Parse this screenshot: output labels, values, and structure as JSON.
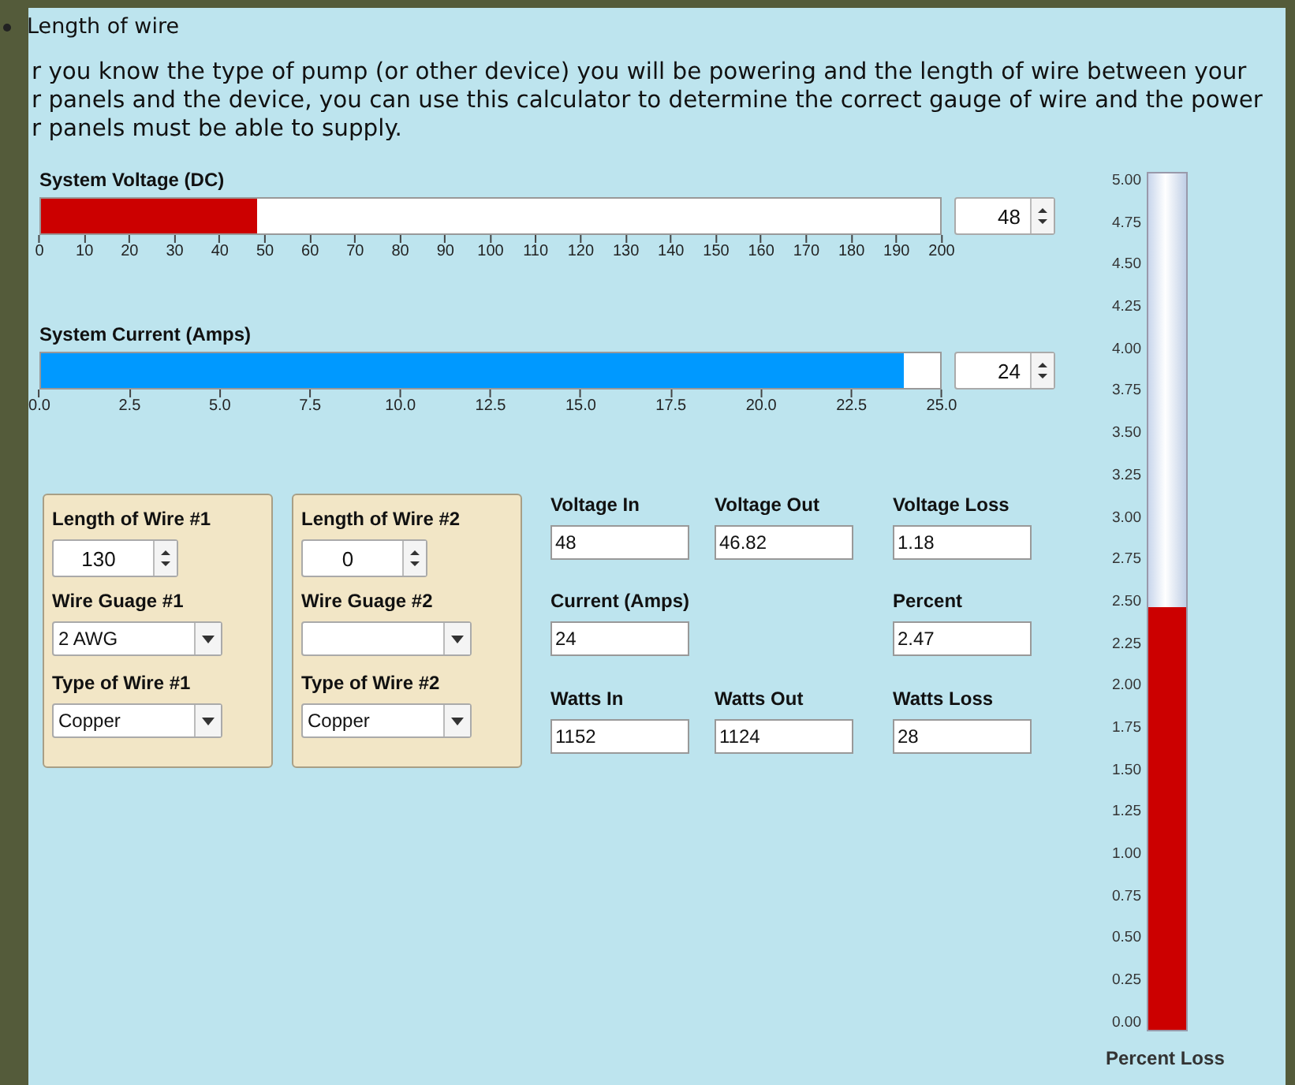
{
  "intro": {
    "bullet_item": "Length of wire",
    "paragraph_lines": [
      "r you know the type of pump (or other device) you will be powering and the length of wire between your",
      "r panels and the device, you can use this calculator to determine the correct gauge of wire and the power",
      "r panels must be able to supply."
    ]
  },
  "sliders": [
    {
      "label": "System Voltage (DC)",
      "level": 0.24,
      "color": "#cc0000",
      "value": "48",
      "ticks": [
        "0",
        "10",
        "20",
        "30",
        "40",
        "50",
        "60",
        "70",
        "80",
        "90",
        "100",
        "110",
        "120",
        "130",
        "140",
        "150",
        "160",
        "170",
        "180",
        "190",
        "200"
      ]
    },
    {
      "label": "System Current (Amps)",
      "level": 0.96,
      "color": "#0099ff",
      "value": "24",
      "ticks": [
        "0.0",
        "2.5",
        "5.0",
        "7.5",
        "10.0",
        "12.5",
        "15.0",
        "17.5",
        "20.0",
        "22.5",
        "25.0"
      ]
    }
  ],
  "wires": [
    {
      "length_label": "Length of Wire #1",
      "length": "130",
      "gauge_label": "Wire Guage #1",
      "gauge": "2 AWG",
      "type_label": "Type of Wire #1",
      "type": "Copper"
    },
    {
      "length_label": "Length of Wire #2",
      "length": "0",
      "gauge_label": "Wire Guage #2",
      "type_label": "Type of Wire #2",
      "type": "Copper"
    }
  ],
  "results": [
    {
      "left": {
        "label": "Voltage In",
        "value": "48"
      },
      "middle": {
        "label": "Voltage Out",
        "value": "46.82"
      },
      "right": {
        "label": "Voltage Loss",
        "value": "1.18"
      }
    },
    {
      "left": {
        "label": "Current (Amps)",
        "value": "24"
      },
      "right": {
        "label": "Percent",
        "value": "2.47"
      }
    },
    {
      "left": {
        "label": "Watts In",
        "value": "1152"
      },
      "middle": {
        "label": "Watts Out",
        "value": "1124"
      },
      "right": {
        "label": "Watts Loss",
        "value": "28"
      }
    }
  ],
  "meter": {
    "level": 0.494,
    "label": "Percent Loss",
    "ticks": [
      "5.00",
      "4.75",
      "4.50",
      "4.25",
      "4.00",
      "3.75",
      "3.50",
      "3.25",
      "3.00",
      "2.75",
      "2.50",
      "2.25",
      "2.00",
      "1.75",
      "1.50",
      "1.25",
      "1.00",
      "0.75",
      "0.50",
      "0.25",
      "0.00"
    ]
  }
}
